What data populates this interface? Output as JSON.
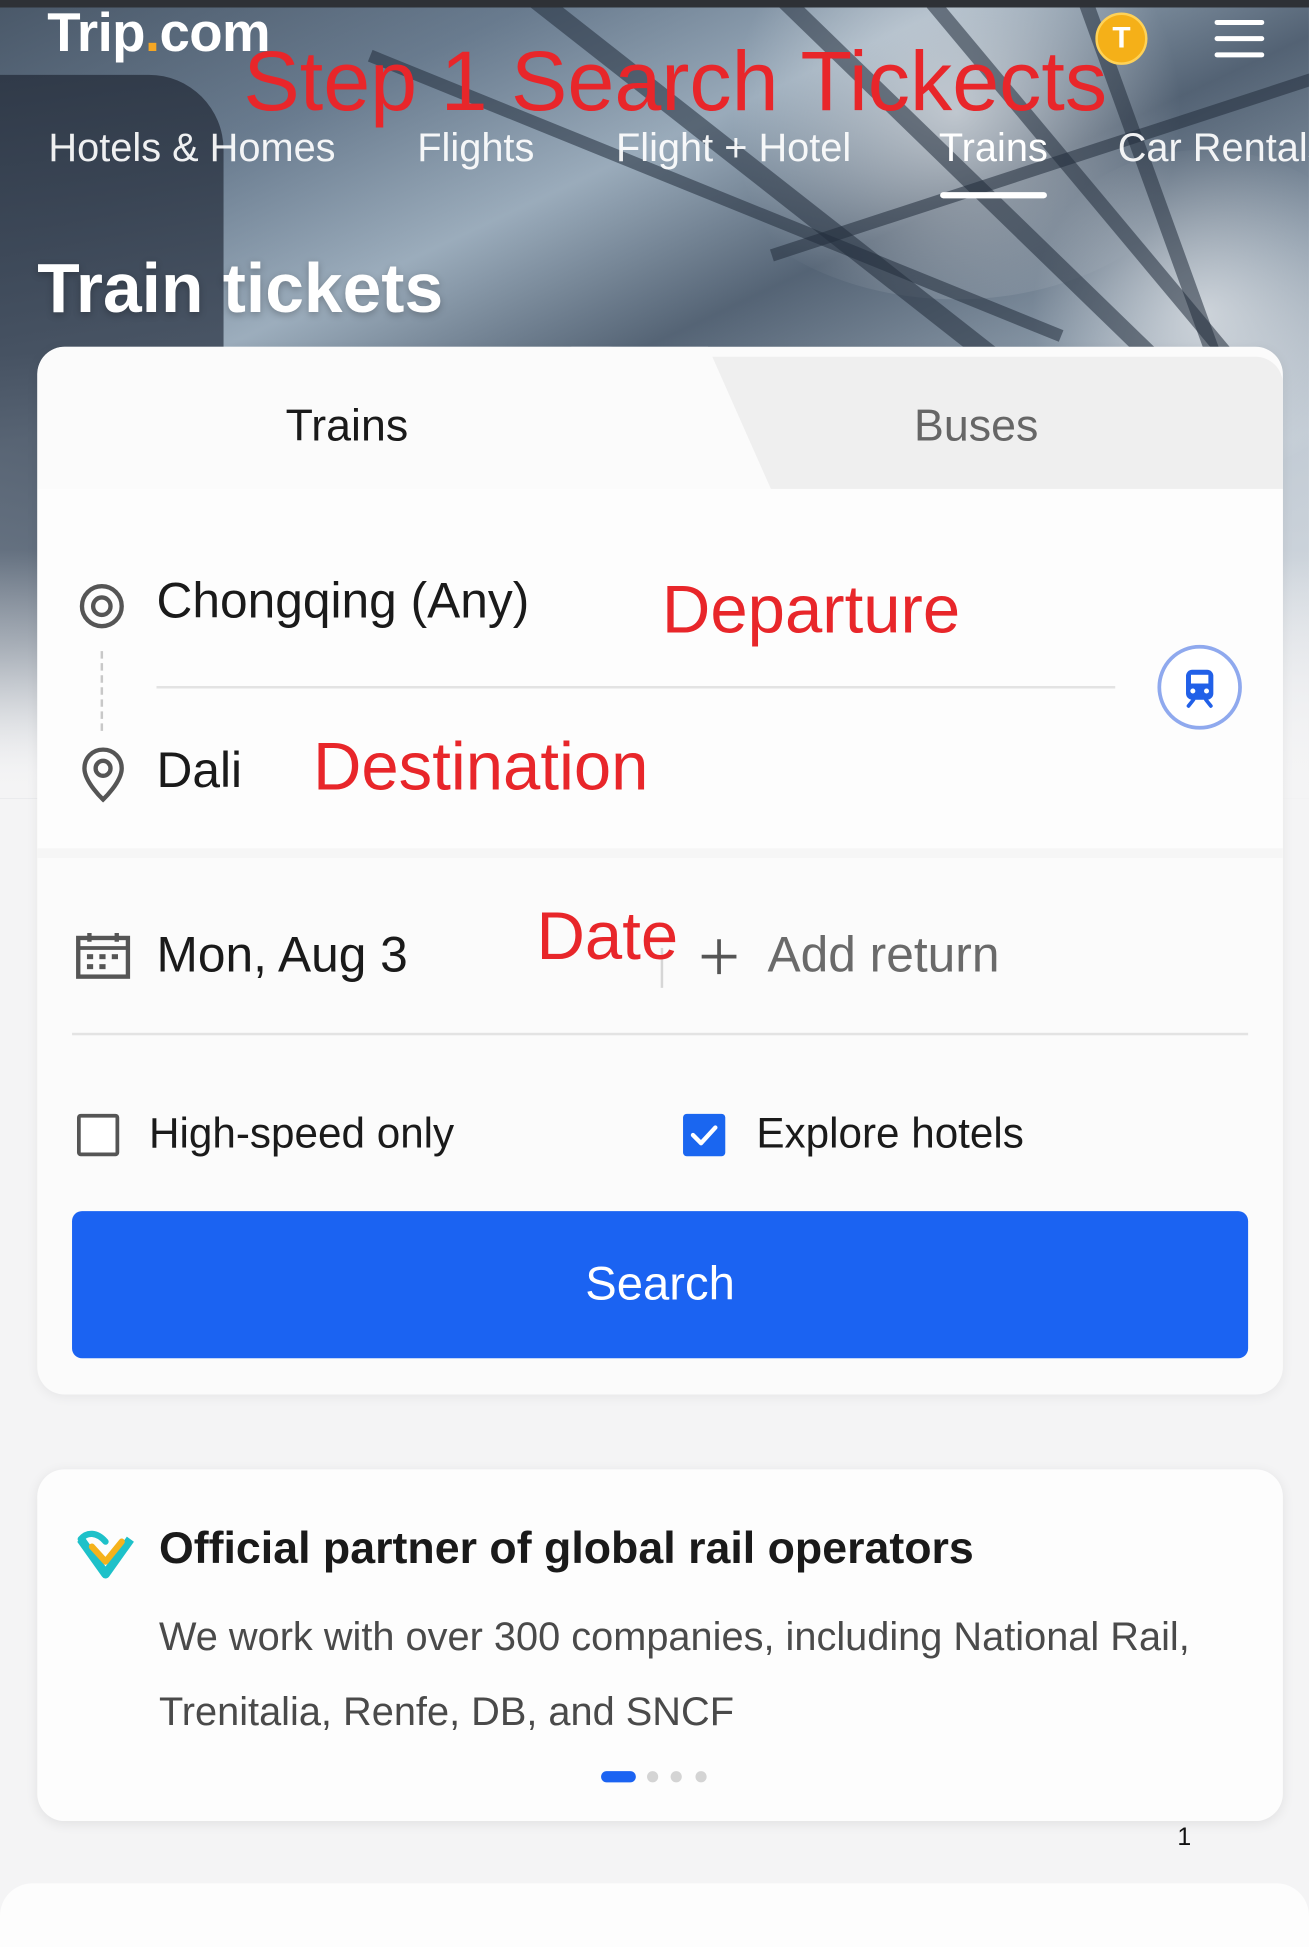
{
  "brand": {
    "logo_text": "Trip.com",
    "dot_color": "#f5a623"
  },
  "header": {
    "member_badge": "T"
  },
  "nav": {
    "tabs": [
      {
        "label": "Hotels & Homes"
      },
      {
        "label": "Flights"
      },
      {
        "label": "Flight + Hotel"
      },
      {
        "label": "Trains",
        "active": true
      },
      {
        "label": "Car Rentals"
      }
    ]
  },
  "hero": {
    "title": "Train tickets"
  },
  "annotations": {
    "step": "Step 1 Search Tickects",
    "departure": "Departure",
    "destination": "Destination",
    "date": "Date",
    "color": "#e8262a"
  },
  "search_card": {
    "tabs": [
      {
        "label": "Trains",
        "active": true
      },
      {
        "label": "Buses",
        "active": false
      }
    ],
    "departure_value": "Chongqing (Any)",
    "destination_value": "Dali",
    "date_value": "Mon, Aug 3",
    "add_return_label": "Add return",
    "options": [
      {
        "label": "High-speed only",
        "checked": false
      },
      {
        "label": "Explore hotels",
        "checked": true
      }
    ],
    "search_button_label": "Search",
    "accent_color": "#1b63f2"
  },
  "partner": {
    "title": "Official partner of global rail operators",
    "description": "We work with over 300 companies, including National Rail, Trenitalia, Renfe, DB, and SNCF",
    "carousel_pages": 4,
    "carousel_active_index": 0
  },
  "page_number": "1"
}
